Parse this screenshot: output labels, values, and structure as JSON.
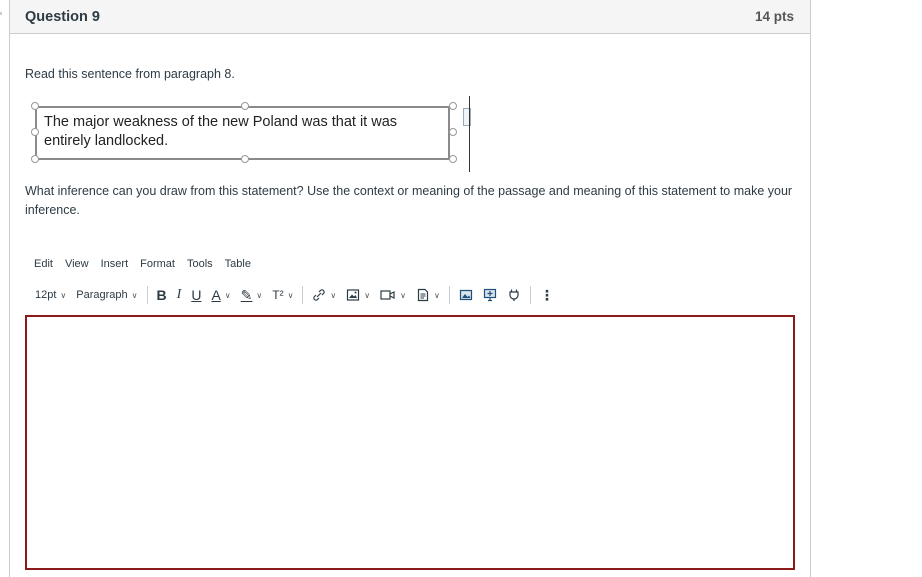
{
  "question": {
    "title": "Question 9",
    "points": "14 pts",
    "intro": "Read this sentence from paragraph 8.",
    "quote": "The major weakness of the new Poland was that it was entirely landlocked.",
    "prompt": "What inference can you draw from this statement?  Use the context or meaning of the passage and meaning of this statement to make your inference."
  },
  "editor": {
    "menu": [
      "Edit",
      "View",
      "Insert",
      "Format",
      "Tools",
      "Table"
    ],
    "font_size": "12pt",
    "block_format": "Paragraph",
    "toolbar_icons": {
      "bold": "B",
      "italic": "I",
      "underline": "U",
      "text_color": "A",
      "highlight": "✎",
      "superscript": "T²",
      "more": "⋮"
    },
    "content": "",
    "border_color": "#8b1a1a"
  }
}
